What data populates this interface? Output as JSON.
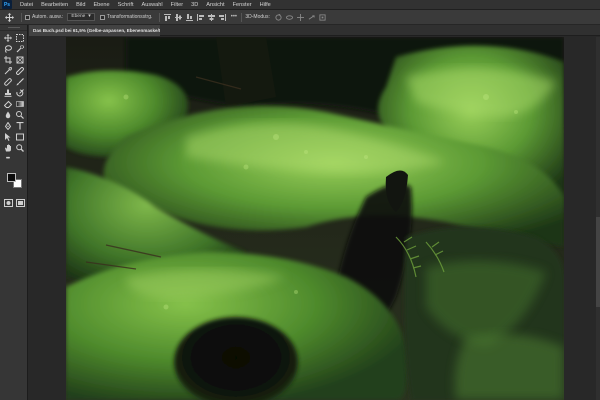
{
  "menubar": {
    "logo": "Ps",
    "items": [
      "Datei",
      "Bearbeiten",
      "Bild",
      "Ebene",
      "Schrift",
      "Auswahl",
      "Filter",
      "3D",
      "Ansicht",
      "Fenster",
      "Hilfe"
    ]
  },
  "options": {
    "autoselect_label": "Autom. ausw.:",
    "layer_select": "Ebene",
    "transform_label": "Transformationsstrg.",
    "mode_label": "3D-Modus:"
  },
  "document": {
    "tab_title": "Das Buch.psd bei 61,5% (Gelbe-anpassen, Ebenenmaske/8) *",
    "tab_close": "×"
  },
  "colors": {
    "foreground": "#0c0c0c",
    "background": "#ffffff",
    "accent": "#31a8ff"
  },
  "tools": [
    "move-icon",
    "marquee-icon",
    "lasso-icon",
    "quick-select-icon",
    "crop-icon",
    "frame-icon",
    "eyedropper-icon",
    "ruler-icon",
    "healing-icon",
    "brush-icon",
    "clone-stamp-icon",
    "history-brush-icon",
    "eraser-icon",
    "gradient-icon",
    "blur-icon",
    "dodge-icon",
    "pen-icon",
    "type-icon",
    "path-select-icon",
    "rectangle-icon",
    "hand-icon",
    "zoom-icon",
    "more-tools-icon"
  ]
}
